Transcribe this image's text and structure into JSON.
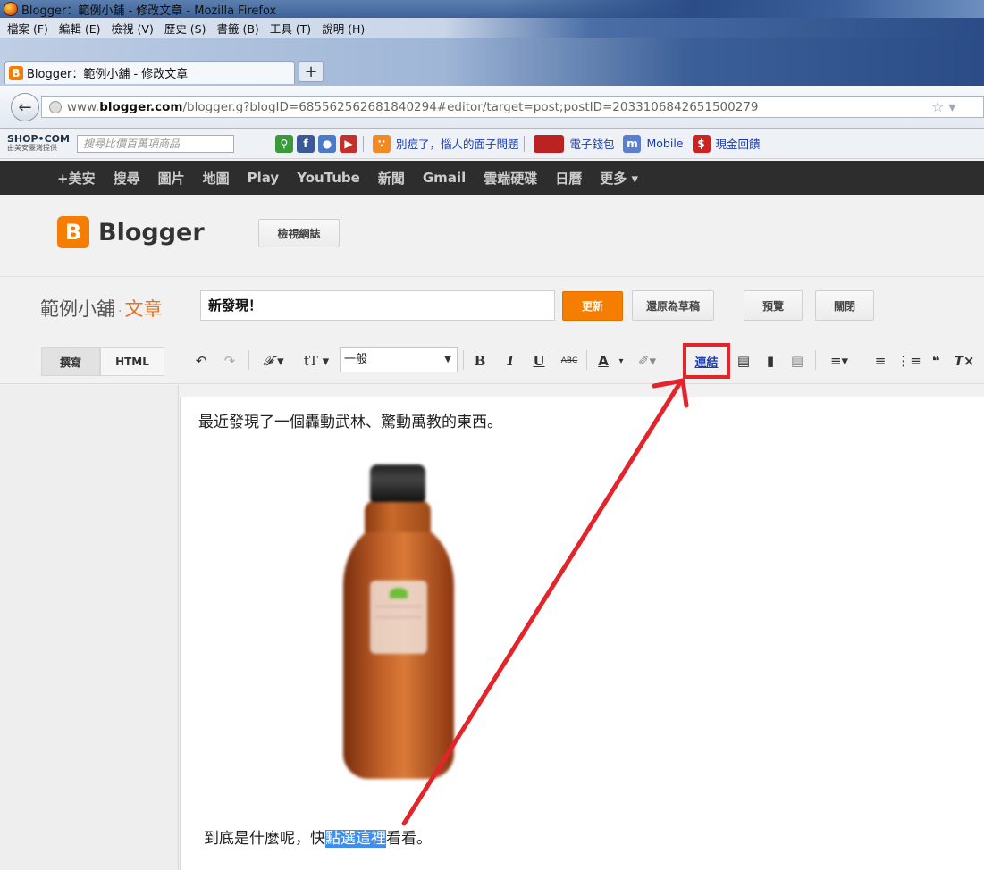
{
  "window": {
    "title": "Blogger：範例小舖 - 修改文章 - Mozilla Firefox"
  },
  "menu": [
    "檔案 (F)",
    "編輯 (E)",
    "檢視 (V)",
    "歷史 (S)",
    "書籤 (B)",
    "工具 (T)",
    "說明 (H)"
  ],
  "tab": {
    "label": "Blogger：範例小舖 - 修改文章",
    "new_tab": "+"
  },
  "url": {
    "prefix": "www.",
    "domain": "blogger.com",
    "path": "/blogger.g?blogID=685562562681840294#editor/target=post;postID=2033106842651500279"
  },
  "bookmarks": {
    "shop_brand": "SHOP•COM",
    "shop_sub": "由美安臺灣提供",
    "search_placeholder": "搜尋比價百萬項商品",
    "link_rss": "別痘了，惱人的面子問題",
    "link_wallet": "電子錢包",
    "link_mobile": "Mobile",
    "link_cash": "現金回饋"
  },
  "google_bar": [
    "+美安",
    "搜尋",
    "圖片",
    "地圖",
    "Play",
    "YouTube",
    "新聞",
    "Gmail",
    "雲端硬碟",
    "日曆",
    "更多 ▾"
  ],
  "blogger": {
    "logo_letter": "B",
    "name": "Blogger",
    "view_blog": "檢視網誌"
  },
  "post": {
    "blog_name": "範例小舖",
    "separator": "·",
    "section": "文章",
    "title_value": "新發現！",
    "update": "更新",
    "revert": "還原為草稿",
    "preview": "預覽",
    "close": "關閉"
  },
  "toolbar": {
    "compose": "撰寫",
    "html": "HTML",
    "font_size_label": "一般",
    "bold": "B",
    "italic": "I",
    "underline": "U",
    "strike": "ABC",
    "text_color": "A",
    "link": "連結"
  },
  "content": {
    "para1": "最近發現了一個轟動武林、驚動萬教的東西。",
    "para2_before": "到底是什麼呢，快",
    "para2_selected": "點選這裡",
    "para2_after": "看看。"
  },
  "colors": {
    "accent": "#f57d00",
    "annotation": "#e3242b",
    "selection": "#3b8ff0"
  }
}
